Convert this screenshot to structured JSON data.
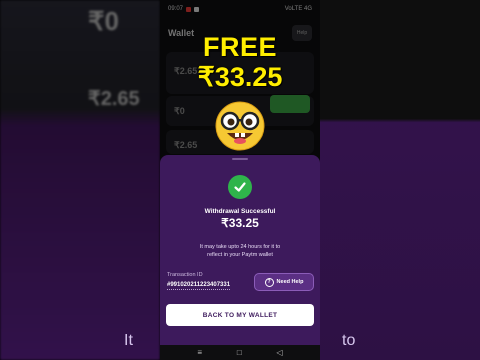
{
  "background": {
    "left_values": [
      "₹0",
      "₹2.65",
      "₹2.65"
    ],
    "bottom_left_text": "It",
    "bottom_right_text": "to"
  },
  "status_bar": {
    "time": "09:07",
    "signal": "VoLTE 4G"
  },
  "app": {
    "title": "Wallet",
    "help": "Help",
    "bg_values": [
      "₹0",
      "₹2.65",
      "₹0",
      "₹2.65"
    ]
  },
  "promo": {
    "headline": "FREE",
    "amount": "₹33.25",
    "emoji": "nerd-face"
  },
  "sheet": {
    "title": "Withdrawal Successful",
    "amount": "₹33.25",
    "info_line1": "It may take upto 24 hours for it to",
    "info_line2": "reflect in your Paytm wallet",
    "txn_label": "Transaction ID",
    "txn_id": "#991020211223407331",
    "need_help_label": "Need Help",
    "back_button_label": "BACK TO MY WALLET"
  },
  "colors": {
    "accent_yellow": "#ffee00",
    "sheet_purple": "#3d1a5c",
    "success_green": "#2fb44b"
  }
}
